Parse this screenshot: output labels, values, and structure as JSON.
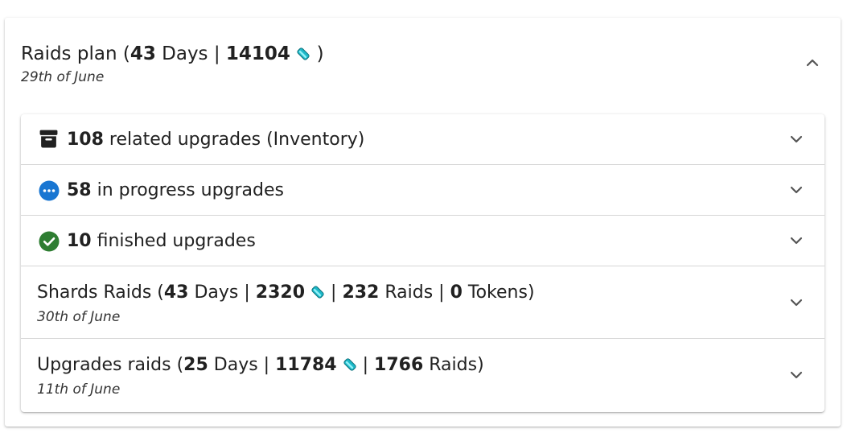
{
  "raids_plan": {
    "title_prefix": "Raids plan (",
    "days_value": "43",
    "days_word": " Days | ",
    "energy_value": "14104",
    "title_suffix": " )",
    "date": "29th of June"
  },
  "rows": {
    "inventory": {
      "count": "108",
      "label": " related upgrades (Inventory)"
    },
    "in_progress": {
      "count": "58",
      "label": " in progress upgrades"
    },
    "finished": {
      "count": "10",
      "label": " finished upgrades"
    },
    "shards_raids": {
      "prefix": "Shards Raids (",
      "days": "43",
      "days_word": " Days | ",
      "energy": "2320",
      "sep1": " | ",
      "raids": "232",
      "raids_word": " Raids | ",
      "tokens": "0",
      "tokens_word": " Tokens)",
      "date": "30th of June"
    },
    "upgrades_raids": {
      "prefix": "Upgrades raids (",
      "days": "25",
      "days_word": " Days | ",
      "energy": "11784",
      "sep1": " | ",
      "raids": "1766",
      "raids_word": " Raids)",
      "date": "11th of June"
    }
  },
  "icons": {
    "archive": "archive-icon",
    "in_progress": "more-horizontal-circle-icon",
    "finished": "check-circle-icon",
    "energy": "energy-crystal-icon",
    "expand": "chevron-down-icon",
    "collapse": "chevron-up-icon"
  },
  "colors": {
    "in_progress_blue": "#1976d2",
    "finished_green": "#2e7d32",
    "crystal_teal": "#1cb8c8"
  }
}
